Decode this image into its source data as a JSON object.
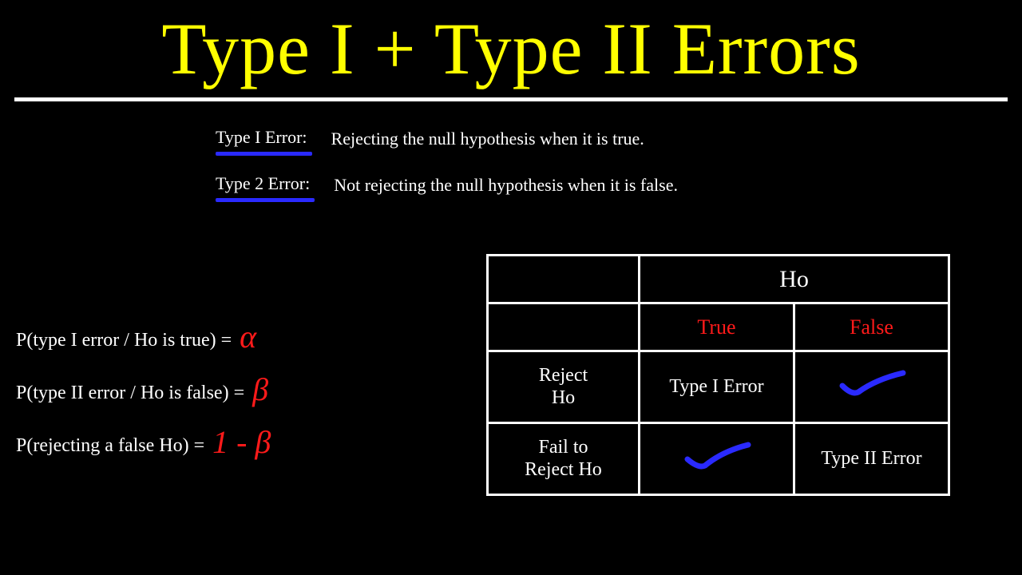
{
  "title": "Type I + Type II Errors",
  "definitions": {
    "type1": {
      "label": "Type I Error:",
      "text": "Rejecting the null hypothesis when it is true."
    },
    "type2": {
      "label": "Type 2 Error:",
      "text": "Not rejecting the null hypothesis when it is false."
    }
  },
  "equations": {
    "eq1": {
      "text": "P(type I error / Ho is true)  =",
      "symbol": "α"
    },
    "eq2": {
      "text": "P(type II error / Ho is false)  =",
      "symbol": "β"
    },
    "eq3": {
      "text": "P(rejecting a false Ho) =",
      "symbol": "1 - β"
    }
  },
  "table": {
    "ho": "Ho",
    "true": "True",
    "false": "False",
    "reject": "Reject\nHo",
    "fail": "Fail to\nReject Ho",
    "t1": "Type I Error",
    "t2": "Type II Error"
  }
}
